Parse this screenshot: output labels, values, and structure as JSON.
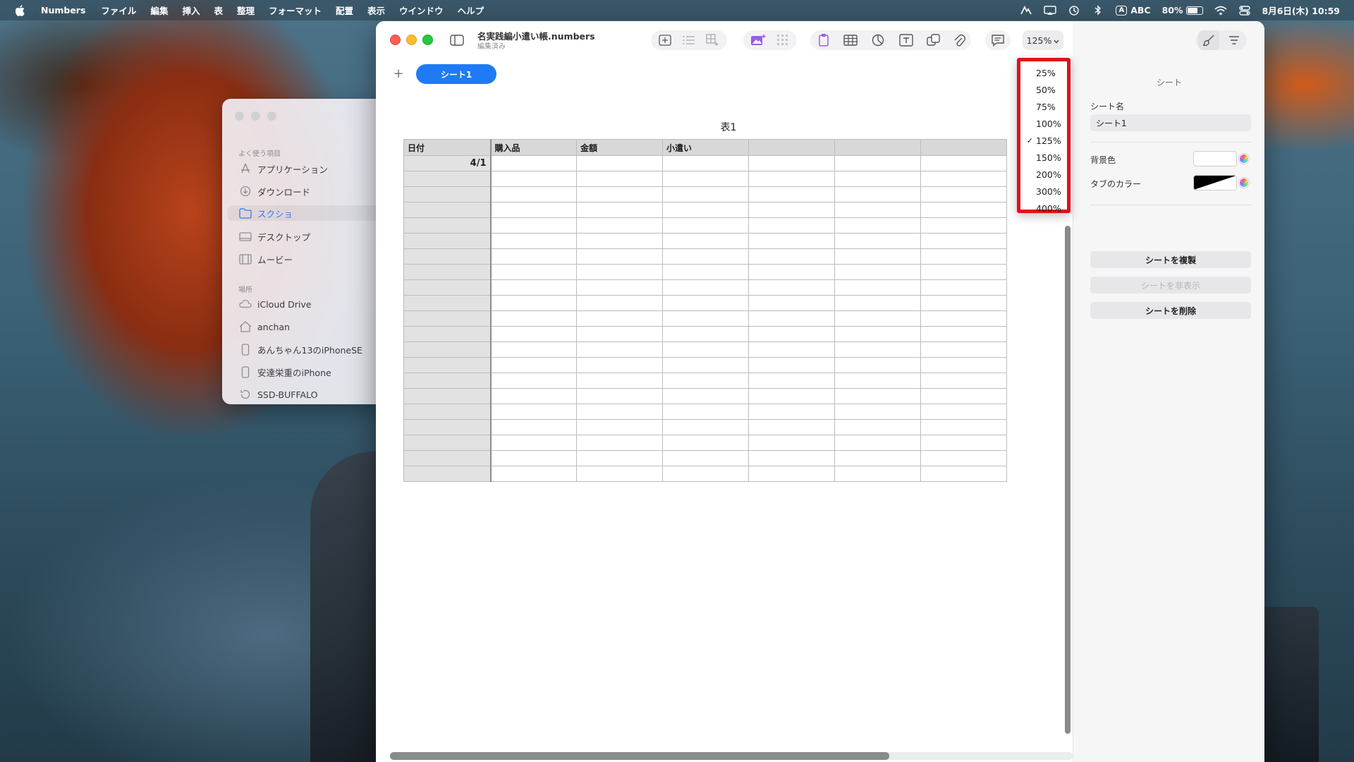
{
  "menubar": {
    "app": "Numbers",
    "items": [
      "ファイル",
      "編集",
      "挿入",
      "表",
      "整理",
      "フォーマット",
      "配置",
      "表示",
      "ウインドウ",
      "ヘルプ"
    ],
    "input_mode": "A",
    "input_label": "ABC",
    "battery": "80%",
    "battery_level": 0.8,
    "datetime": "8月6日(木) 10:59"
  },
  "finder": {
    "favorites_label": "よく使う項目",
    "favorites": [
      {
        "icon": "apps-icon",
        "label": "アプリケーション"
      },
      {
        "icon": "download-icon",
        "label": "ダウンロード"
      },
      {
        "icon": "folder-icon",
        "label": "スクショ"
      },
      {
        "icon": "desktop-icon",
        "label": "デスクトップ"
      },
      {
        "icon": "movie-icon",
        "label": "ムービー"
      }
    ],
    "locations_label": "場所",
    "locations": [
      {
        "icon": "cloud-icon",
        "label": "iCloud Drive"
      },
      {
        "icon": "home-icon",
        "label": "anchan"
      },
      {
        "icon": "phone-icon",
        "label": "あんちゃん13のiPhoneSE"
      },
      {
        "icon": "phone-icon",
        "label": "安達栄重のiPhone"
      },
      {
        "icon": "disk-icon",
        "label": "SSD-BUFFALO"
      }
    ]
  },
  "document": {
    "title": "名実践編小遣い帳.numbers",
    "subtitle": "編集済み",
    "zoom": "125%"
  },
  "sheets": {
    "active": "シート1"
  },
  "table": {
    "title": "表1",
    "headers": [
      "日付",
      "購入品",
      "金額",
      "小遣い",
      "",
      "",
      ""
    ],
    "first_row": [
      "4/1",
      "",
      "",
      "",
      "",
      "",
      ""
    ],
    "empty_row_count": 20
  },
  "zoom_menu": {
    "options": [
      "25%",
      "50%",
      "75%",
      "100%",
      "125%",
      "150%",
      "200%",
      "300%",
      "400%"
    ],
    "selected": "125%"
  },
  "inspector": {
    "heading": "シート",
    "name_label": "シート名",
    "name_value": "シート1",
    "bg_label": "背景色",
    "tab_color_label": "タブのカラー",
    "duplicate": "シートを複製",
    "hide": "シートを非表示",
    "delete": "シートを削除"
  }
}
